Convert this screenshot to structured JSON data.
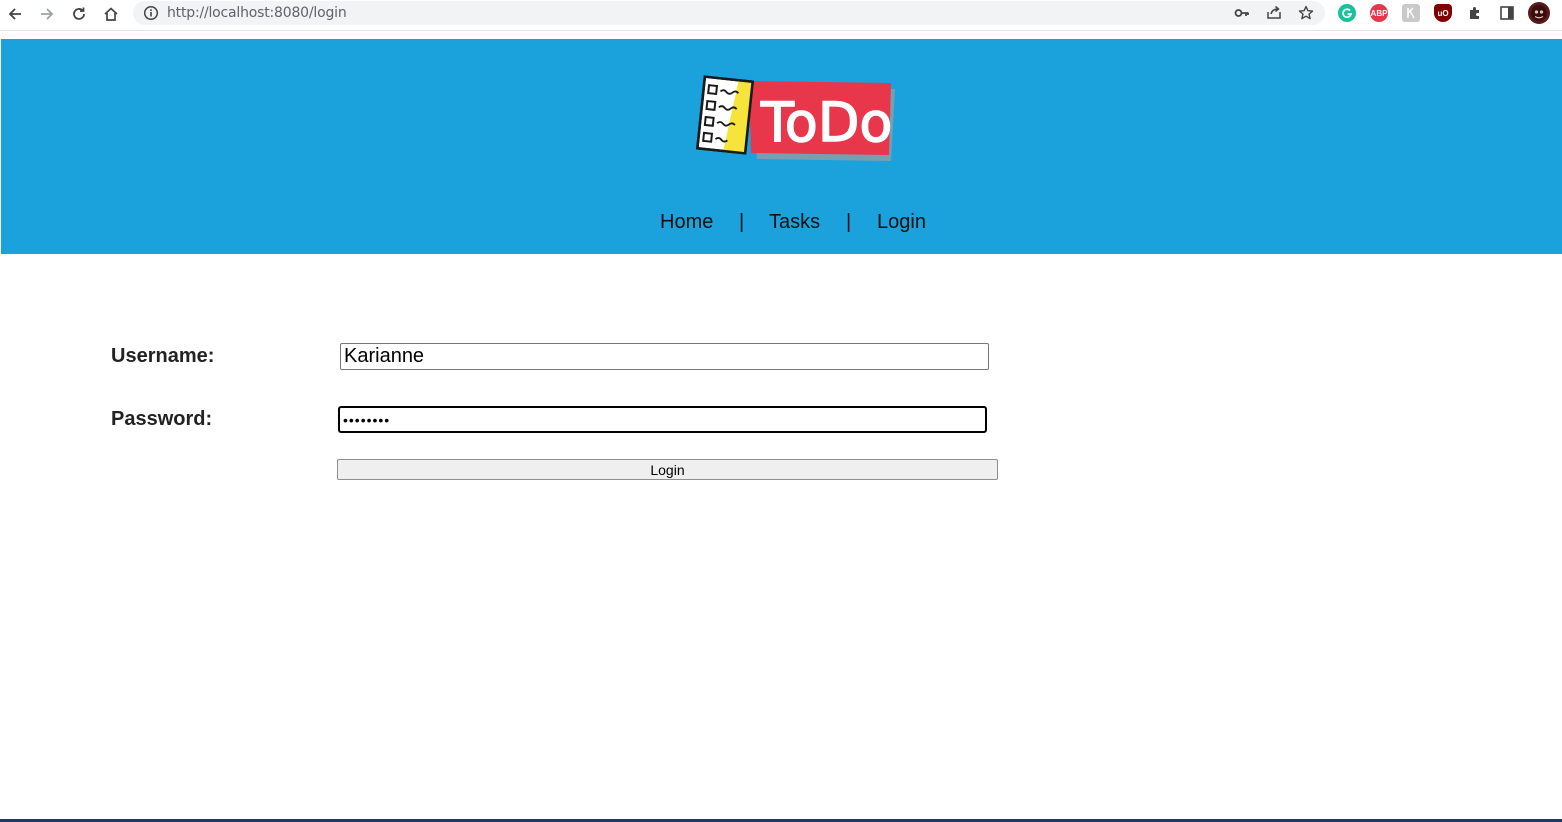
{
  "browser": {
    "url": "http://localhost:8080/login",
    "icons": [
      "back-icon",
      "forward-icon",
      "reload-icon",
      "home-icon",
      "info-icon",
      "key-icon",
      "share-icon",
      "star-icon",
      "grammarly-icon",
      "adblock-icon",
      "extension-icon",
      "ublock-icon",
      "puzzle-icon",
      "sidepanel-icon",
      "profile-avatar"
    ],
    "ext_labels": {
      "adblock": "ABP",
      "ublock": "uO"
    }
  },
  "header": {
    "logo_text": "ToDo",
    "nav": [
      {
        "label": "Home"
      },
      {
        "label": "Tasks"
      },
      {
        "label": "Login"
      }
    ],
    "separator": "|",
    "colors": {
      "background": "#1ba1dc",
      "logo_red": "#e8374a"
    }
  },
  "form": {
    "username_label": "Username:",
    "username_value": "Karianne",
    "password_label": "Password:",
    "password_value": "password",
    "submit_label": "Login"
  }
}
